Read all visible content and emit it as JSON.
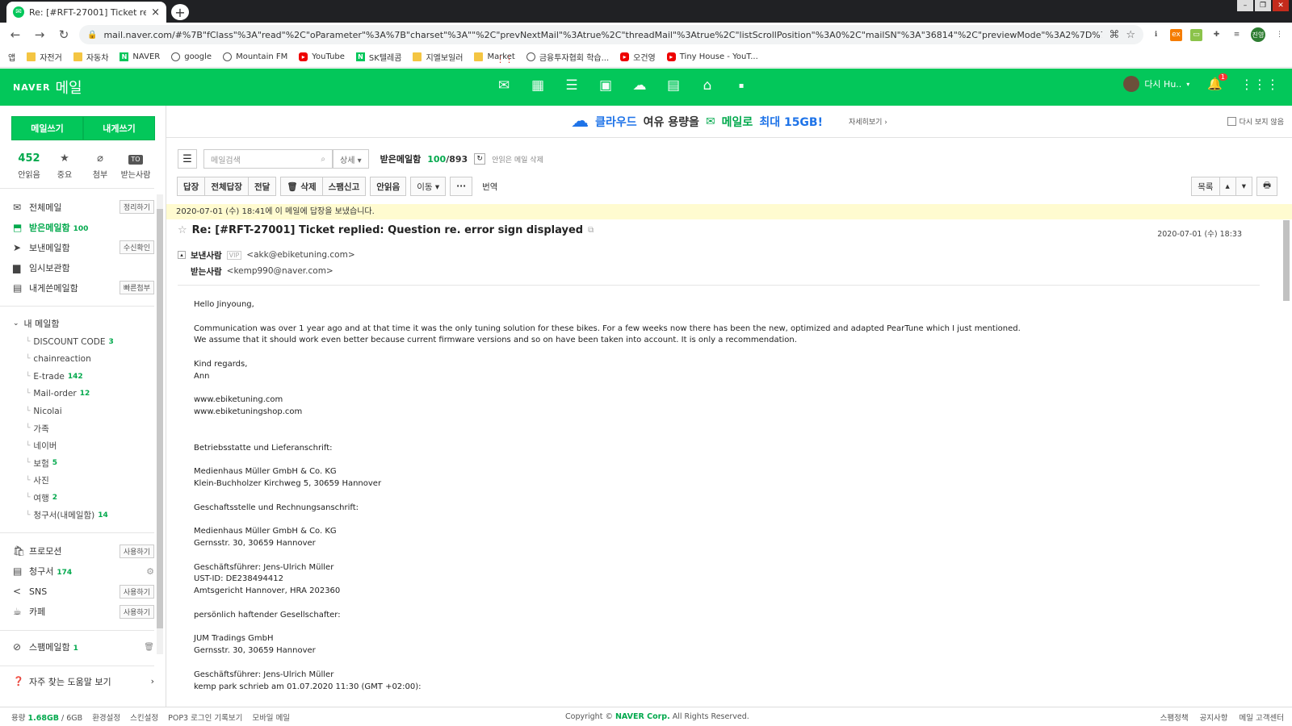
{
  "browser": {
    "tab_title": "Re: [#RFT-27001] Ticket replied: Question re. error sign displayed",
    "tab_close": "×",
    "new_tab": "+",
    "url": "mail.naver.com/#%7B\"fClass\"%3A\"read\"%2C\"oParameter\"%3A%7B\"charset\"%3A\"\"%2C\"prevNextMail\"%3Atrue%2C\"threadMail\"%3Atrue%2C\"listScrollPosition\"%3A0%2C\"mailSN\"%3A\"36814\"%2C\"previewMode\"%3A2%7D%7D",
    "profile": "진영"
  },
  "bookmarks": [
    {
      "label": "앱",
      "icon": "apps"
    },
    {
      "label": "자전거",
      "icon": "folder"
    },
    {
      "label": "자동차",
      "icon": "folder"
    },
    {
      "label": "NAVER",
      "icon": "naver"
    },
    {
      "label": "google",
      "icon": "globe"
    },
    {
      "label": "Mountain FM",
      "icon": "globe"
    },
    {
      "label": "YouTube",
      "icon": "yt"
    },
    {
      "label": "SK텔레콤",
      "icon": "naver"
    },
    {
      "label": "지엘보일러",
      "icon": "folder"
    },
    {
      "label": "Market",
      "icon": "folder"
    },
    {
      "label": "금융투자협회 학습...",
      "icon": "globe"
    },
    {
      "label": "오건영",
      "icon": "yt"
    },
    {
      "label": "Tiny House - YouT...",
      "icon": "yt"
    }
  ],
  "header": {
    "logo_brand": "NAVER",
    "logo_service": "메일",
    "user_name": "다시 Hu..",
    "notif_count": "1"
  },
  "sidebar": {
    "compose": "메일쓰기",
    "self": "내게쓰기",
    "quick": [
      {
        "value": "452",
        "label": "안읽음"
      },
      {
        "icon": "★",
        "label": "중요"
      },
      {
        "icon": "⌀",
        "label": "첨부"
      },
      {
        "icon": "TO",
        "label": "받는사람"
      }
    ],
    "folders": [
      {
        "icon": "✉",
        "label": "전체메일",
        "tag": "정리하기"
      },
      {
        "icon": "⬒",
        "label": "받은메일함",
        "count": "100",
        "active": true
      },
      {
        "icon": "➤",
        "label": "보낸메일함",
        "tag": "수신확인"
      },
      {
        "icon": "▆",
        "label": "임시보관함"
      },
      {
        "icon": "▤",
        "label": "내게쓴메일함",
        "tag": "빠른첨부"
      }
    ],
    "my_mailbox": "내 메일함",
    "subfolders": [
      {
        "label": "DISCOUNT CODE",
        "count": "3"
      },
      {
        "label": "chainreaction"
      },
      {
        "label": "E-trade",
        "count": "142"
      },
      {
        "label": "Mail-order",
        "count": "12"
      },
      {
        "label": "Nicolai"
      },
      {
        "label": "가족"
      },
      {
        "label": "네이버"
      },
      {
        "label": "보험",
        "count": "5"
      },
      {
        "label": "사진"
      },
      {
        "label": "여행",
        "count": "2"
      },
      {
        "label": "청구서(내메일함)",
        "count": "14"
      }
    ],
    "smart": [
      {
        "icon": "🛍",
        "label": "프로모션",
        "tag": "사용하기"
      },
      {
        "icon": "▤",
        "label": "청구서",
        "count": "174",
        "gear": true
      },
      {
        "icon": "<",
        "label": "SNS",
        "tag": "사용하기"
      },
      {
        "icon": "☕",
        "label": "카페",
        "tag": "사용하기"
      }
    ],
    "spam": {
      "label": "스팸메일함",
      "count": "1"
    },
    "help": "자주 찾는 도움말 보기"
  },
  "promo": {
    "t1": "클라우드",
    "t1b": "여유 용량을",
    "t2": "메일로",
    "t3": "최대 15GB!",
    "more": "자세히보기 ›",
    "hide": "다시 보지 않음"
  },
  "listbar": {
    "search_placeholder": "메일검색",
    "detail": "상세 ▾",
    "folder": "받은메일함",
    "count_current": "100",
    "count_total": "/893",
    "delete_unread": "안읽은 메일 삭제"
  },
  "actions": {
    "reply": "답장",
    "reply_all": "전체답장",
    "forward": "전달",
    "delete": "🗑 삭제",
    "spam": "스팸신고",
    "unread": "안읽음",
    "move": "이동 ▾",
    "more": "···",
    "translate": "번역",
    "list": "목록",
    "up": "▴",
    "down": "▾",
    "print": "🖶"
  },
  "mail": {
    "notice": "2020-07-01 (수) 18:41에 이 메일에 답장을 보냈습니다.",
    "subject": "Re: [#RFT-27001] Ticket replied: Question re. error sign displayed",
    "date": "2020-07-01 (수) 18:33",
    "from_label": "보낸사람",
    "vip": "VIP",
    "from": "<akk@ebiketuning.com>",
    "to_label": "받는사람",
    "to": "<kemp990@naver.com>",
    "body": [
      "Hello Jinyoung,",
      "",
      "Communication was over 1 year ago and at that time it was the only tuning solution for these bikes. For a few weeks now there has been the new, optimized and adapted PearTune which I just mentioned.",
      "We assume that it should work even better because current firmware versions and so on have been taken into account. It is only a recommendation.",
      "",
      "Kind regards,",
      "Ann",
      "",
      "www.ebiketuning.com",
      "www.ebiketuningshop.com",
      "",
      "",
      "Betriebsstatte und Lieferanschrift:",
      "",
      "Medienhaus Müller GmbH & Co. KG",
      "Klein-Buchholzer Kirchweg 5, 30659 Hannover",
      "",
      "Geschaftsstelle und Rechnungsanschrift:",
      "",
      "Medienhaus Müller GmbH & Co. KG",
      "Gernsstr. 30, 30659 Hannover",
      "",
      "Geschäftsführer: Jens-Ulrich Müller",
      "UST-ID: DE238494412",
      "Amtsgericht Hannover, HRA 202360",
      "",
      "persönlich haftender Gesellschafter:",
      "",
      "JUM Tradings GmbH",
      "Gernsstr. 30, 30659 Hannover",
      "",
      "Geschäftsführer: Jens-Ulrich Müller",
      "kemp park schrieb am 01.07.2020 11:30 (GMT +02:00):"
    ]
  },
  "footer": {
    "usage_label": "용량",
    "usage_used": "1.68GB",
    "usage_total": "/ 6GB",
    "links": [
      "환경설정",
      "스킨설정",
      "POP3 로그인 기록보기",
      "모바일 메일"
    ],
    "copyright_pre": "Copyright ©",
    "copyright_corp": "NAVER Corp.",
    "copyright_post": "All Rights Reserved.",
    "right_links": [
      "스팸정책",
      "공지사항",
      "메일 고객센터"
    ]
  }
}
